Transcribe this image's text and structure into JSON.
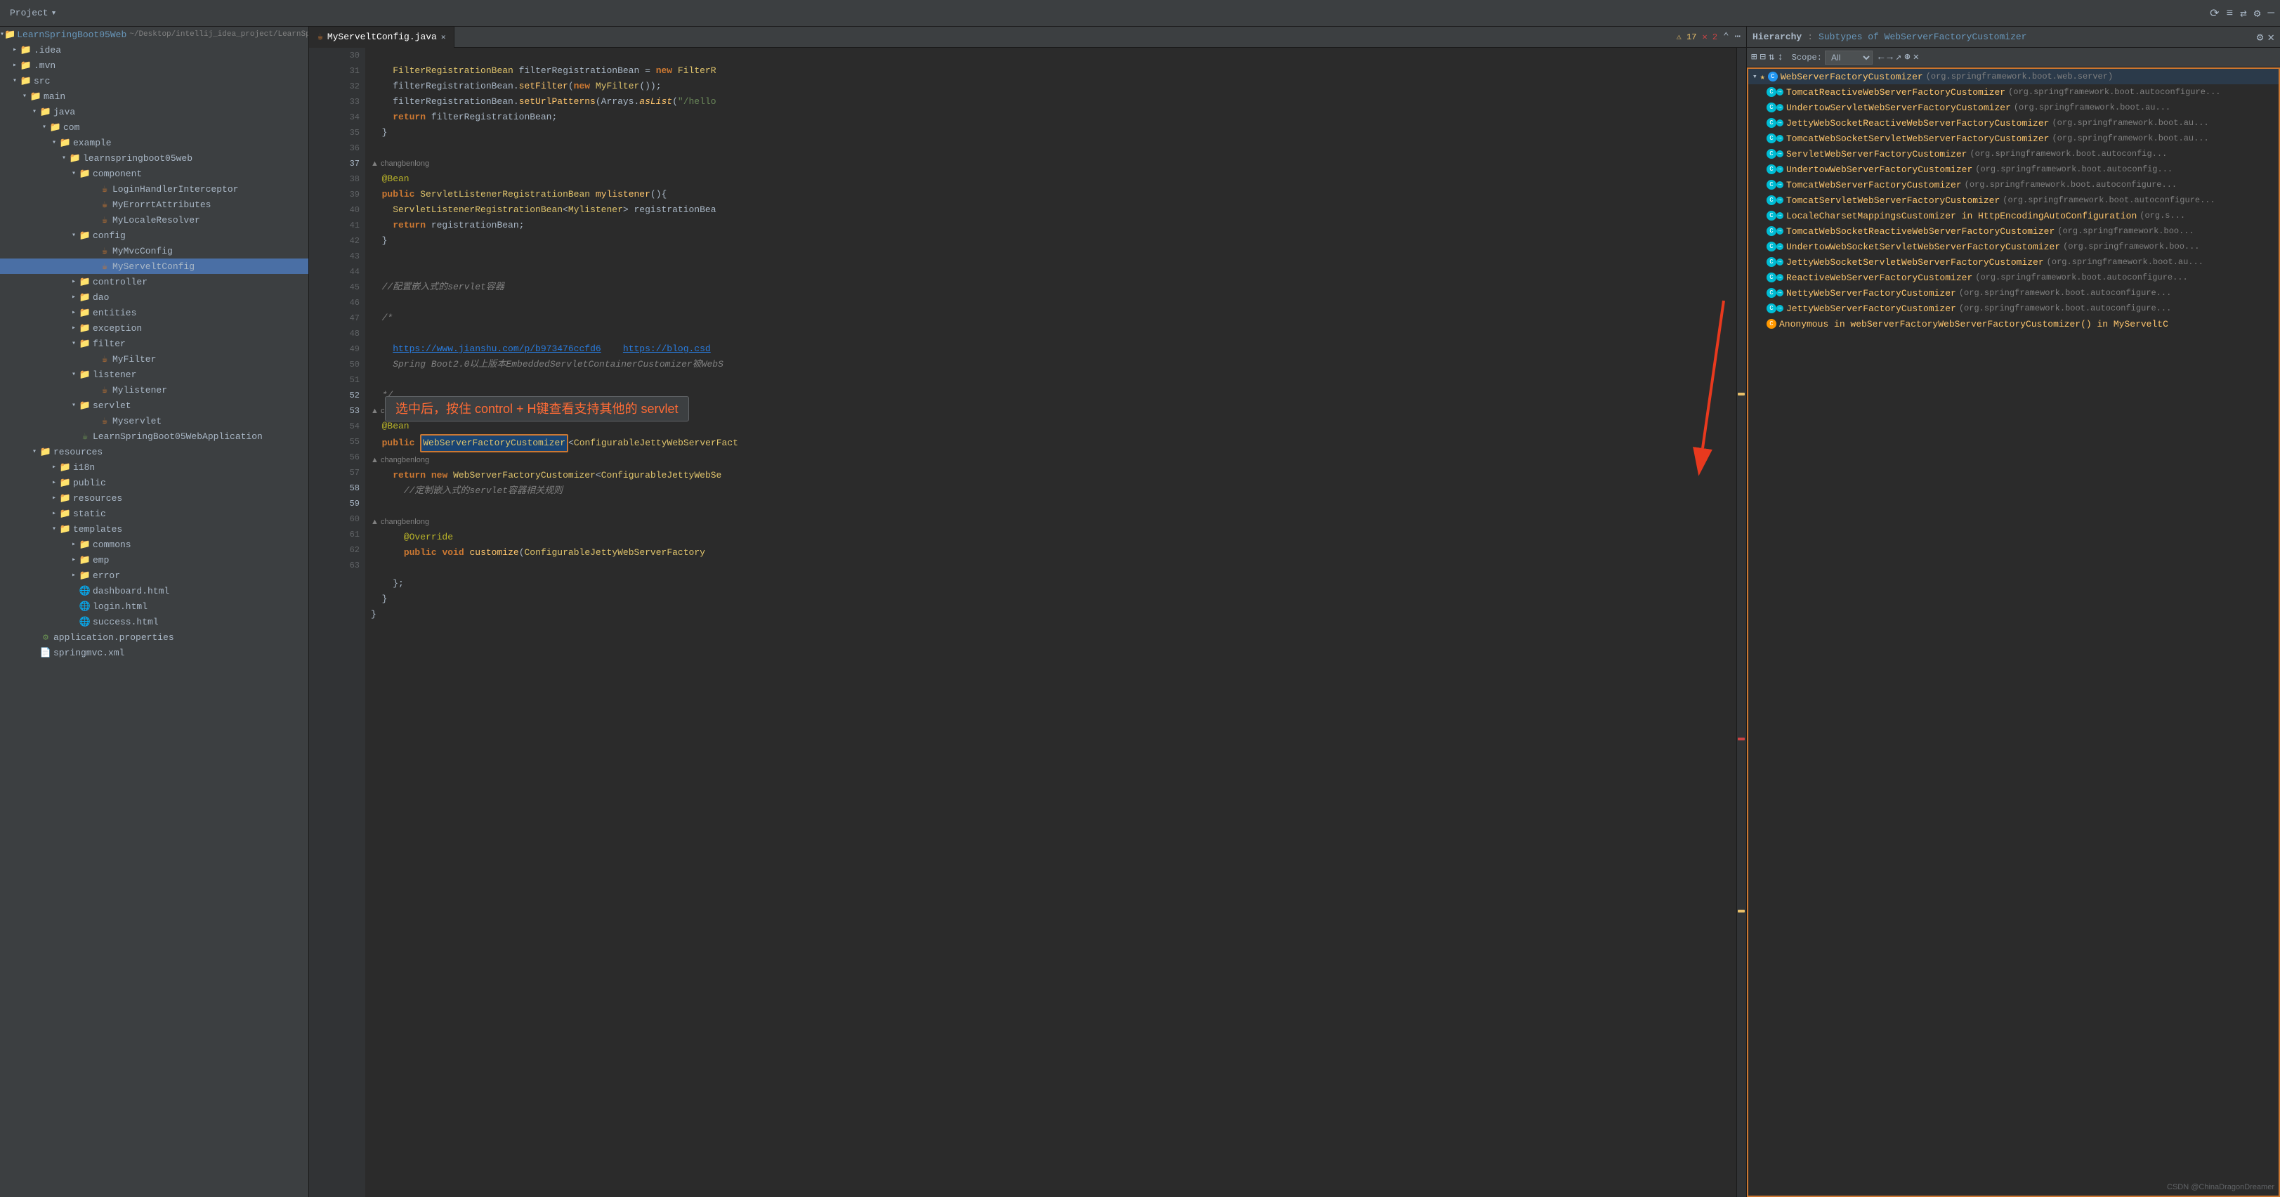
{
  "topbar": {
    "project_label": "Project",
    "dropdown_arrow": "▾"
  },
  "tab": {
    "filename": "MyServeltConfig.java",
    "close": "✕"
  },
  "toolbar": {
    "warnings": "⚠ 17",
    "errors": "✕ 2"
  },
  "sidebar": {
    "title": "Project",
    "items": [
      {
        "id": "root",
        "label": "LearnSpringBoot05Web",
        "sublabel": "~/Desktop/intellij_idea_project/LearnSpringBo...",
        "indent": 0,
        "type": "project",
        "expanded": true
      },
      {
        "id": "idea",
        "label": ".idea",
        "indent": 1,
        "type": "folder",
        "expanded": false
      },
      {
        "id": "mvn",
        "label": ".mvn",
        "indent": 1,
        "type": "folder",
        "expanded": false
      },
      {
        "id": "src",
        "label": "src",
        "indent": 1,
        "type": "folder",
        "expanded": true
      },
      {
        "id": "main",
        "label": "main",
        "indent": 2,
        "type": "folder",
        "expanded": true
      },
      {
        "id": "java",
        "label": "java",
        "indent": 3,
        "type": "folder",
        "expanded": true
      },
      {
        "id": "com",
        "label": "com",
        "indent": 4,
        "type": "package",
        "expanded": true
      },
      {
        "id": "example",
        "label": "example",
        "indent": 5,
        "type": "package",
        "expanded": true
      },
      {
        "id": "learnspringboot05web",
        "label": "learnspringboot05web",
        "indent": 6,
        "type": "package",
        "expanded": true
      },
      {
        "id": "component",
        "label": "component",
        "indent": 7,
        "type": "folder",
        "expanded": true
      },
      {
        "id": "loginhandlerinterceptor",
        "label": "LoginHandlerInterceptor",
        "indent": 8,
        "type": "java"
      },
      {
        "id": "myerrorattributes",
        "label": "MyErorrtAttributes",
        "indent": 8,
        "type": "java"
      },
      {
        "id": "mylocalresolver",
        "label": "MyLocaleResolver",
        "indent": 8,
        "type": "java"
      },
      {
        "id": "config",
        "label": "config",
        "indent": 7,
        "type": "folder",
        "expanded": true
      },
      {
        "id": "mymvcconfig",
        "label": "MyMvcConfig",
        "indent": 8,
        "type": "java"
      },
      {
        "id": "myserveltconfig",
        "label": "MyServeltConfig",
        "indent": 8,
        "type": "java",
        "selected": true
      },
      {
        "id": "controller",
        "label": "controller",
        "indent": 7,
        "type": "folder",
        "expanded": false
      },
      {
        "id": "dao",
        "label": "dao",
        "indent": 7,
        "type": "folder",
        "expanded": false
      },
      {
        "id": "entities",
        "label": "entities",
        "indent": 7,
        "type": "folder",
        "expanded": false
      },
      {
        "id": "exception",
        "label": "exception",
        "indent": 7,
        "type": "folder",
        "expanded": false
      },
      {
        "id": "filter",
        "label": "filter",
        "indent": 7,
        "type": "folder",
        "expanded": true
      },
      {
        "id": "myfilter",
        "label": "MyFilter",
        "indent": 8,
        "type": "java"
      },
      {
        "id": "listener",
        "label": "listener",
        "indent": 7,
        "type": "folder",
        "expanded": true
      },
      {
        "id": "mylistener",
        "label": "Mylistener",
        "indent": 8,
        "type": "java"
      },
      {
        "id": "servlet",
        "label": "servlet",
        "indent": 7,
        "type": "folder",
        "expanded": true
      },
      {
        "id": "myservlet",
        "label": "Myservlet",
        "indent": 8,
        "type": "java"
      },
      {
        "id": "learnapp",
        "label": "LearnSpringBoot05WebApplication",
        "indent": 7,
        "type": "java"
      },
      {
        "id": "resources",
        "label": "resources",
        "indent": 3,
        "type": "folder",
        "expanded": true
      },
      {
        "id": "i18n",
        "label": "i18n",
        "indent": 4,
        "type": "folder",
        "expanded": false
      },
      {
        "id": "public",
        "label": "public",
        "indent": 4,
        "type": "folder",
        "expanded": false
      },
      {
        "id": "resources2",
        "label": "resources",
        "indent": 4,
        "type": "folder",
        "expanded": false
      },
      {
        "id": "static",
        "label": "static",
        "indent": 4,
        "type": "folder",
        "expanded": false
      },
      {
        "id": "templates",
        "label": "templates",
        "indent": 4,
        "type": "folder",
        "expanded": true
      },
      {
        "id": "commons",
        "label": "commons",
        "indent": 5,
        "type": "folder",
        "expanded": false
      },
      {
        "id": "emp",
        "label": "emp",
        "indent": 5,
        "type": "folder",
        "expanded": false
      },
      {
        "id": "error",
        "label": "error",
        "indent": 5,
        "type": "folder",
        "expanded": false
      },
      {
        "id": "dashboard_html",
        "label": "dashboard.html",
        "indent": 5,
        "type": "html"
      },
      {
        "id": "login_html",
        "label": "login.html",
        "indent": 5,
        "type": "html"
      },
      {
        "id": "success_html",
        "label": "success.html",
        "indent": 5,
        "type": "html"
      },
      {
        "id": "app_properties",
        "label": "application.properties",
        "indent": 3,
        "type": "properties"
      },
      {
        "id": "springmvc_xml",
        "label": "springmvc.xml",
        "indent": 3,
        "type": "xml"
      }
    ]
  },
  "code": {
    "lines": [
      {
        "num": 30,
        "content": "",
        "type": "blank"
      },
      {
        "num": 31,
        "content": "    FilterRegistrationBean filterRegistrationBean = new FilterR",
        "type": "code"
      },
      {
        "num": 32,
        "content": "    filterRegistrationBean.setFilter(new MyFilter());",
        "type": "code"
      },
      {
        "num": 33,
        "content": "    filterRegistrationBean.setUrlPatterns(Arrays.asList(\"/hello",
        "type": "code"
      },
      {
        "num": 34,
        "content": "    return filterRegistrationBean;",
        "type": "code"
      },
      {
        "num": 35,
        "content": "  }",
        "type": "code"
      },
      {
        "num": 36,
        "content": "",
        "type": "blank"
      },
      {
        "num": 37,
        "content": "  @Bean",
        "type": "annotation",
        "author": "changbenlong"
      },
      {
        "num": 38,
        "content": "  public ServletListenerRegistrationBean mylistener(){",
        "type": "code"
      },
      {
        "num": 39,
        "content": "    ServletListenerRegistrationBean<Mylistener> registrationBea",
        "type": "code"
      },
      {
        "num": 40,
        "content": "    return registrationBean;",
        "type": "code"
      },
      {
        "num": 41,
        "content": "  }",
        "type": "code"
      },
      {
        "num": 42,
        "content": "",
        "type": "blank"
      },
      {
        "num": 43,
        "content": "",
        "type": "blank"
      },
      {
        "num": 44,
        "content": "  //配置嵌入式的servlet容器",
        "type": "comment"
      },
      {
        "num": 45,
        "content": "",
        "type": "blank"
      },
      {
        "num": 46,
        "content": "  /*",
        "type": "comment"
      },
      {
        "num": 47,
        "content": "",
        "type": "blank"
      },
      {
        "num": 48,
        "content": "    https://www.jianshu.com/p/b973476ccfd6    https://blog.csd",
        "type": "link"
      },
      {
        "num": 49,
        "content": "    Spring Boot2.0以上版本EmbeddedServletContainerCustomizer被WebS",
        "type": "comment"
      },
      {
        "num": 50,
        "content": "",
        "type": "blank"
      },
      {
        "num": 51,
        "content": "  */",
        "type": "comment"
      },
      {
        "num": 52,
        "content": "  @Bean",
        "type": "annotation",
        "author": "changbenlong"
      },
      {
        "num": 53,
        "content": "  public WebServerFactoryCustomizer<ConfigurableJettyWebServerFact",
        "type": "code",
        "highlight": "WebServerFactoryCustomizer"
      },
      {
        "num": 54,
        "content": "",
        "type": "blank",
        "author": "changbenlong"
      },
      {
        "num": 55,
        "content": "    return new WebServerFactoryCustomizer<ConfigurableJettyWebSe",
        "type": "code"
      },
      {
        "num": 56,
        "content": "      //定制嵌入式的servlet容器相关规则",
        "type": "comment"
      },
      {
        "num": 57,
        "content": "",
        "type": "blank"
      },
      {
        "num": 58,
        "content": "      @Override",
        "type": "annotation",
        "author": "changbenlong"
      },
      {
        "num": 59,
        "content": "      public void customize(ConfigurableJettyWebServerFactory",
        "type": "code"
      },
      {
        "num": 60,
        "content": "",
        "type": "blank"
      },
      {
        "num": 61,
        "content": "    };",
        "type": "code"
      },
      {
        "num": 62,
        "content": "  }",
        "type": "code"
      },
      {
        "num": 63,
        "content": "}",
        "type": "code"
      }
    ]
  },
  "hierarchy": {
    "title": "Hierarchy",
    "subtitle": "Subtypes of WebServerFactoryCustomizer",
    "close": "✕",
    "scope_label": "Scope:",
    "scope_value": "All",
    "items": [
      {
        "id": "root",
        "type": "root",
        "expanded": true,
        "icon_type": "star",
        "classname": "WebServerFactoryCustomizer",
        "package": "(org.springframework.boot.web.server)",
        "indent": 0
      },
      {
        "id": "tomcat_reactive",
        "type": "leaf",
        "icon_type": "cyan",
        "classname": "TomcatReactiveWebServerFactoryCustomizer",
        "package": "(org.springframework.boot.autoconfigure...",
        "indent": 1
      },
      {
        "id": "undertow_servlet",
        "type": "leaf",
        "icon_type": "cyan",
        "classname": "UndertowServletWebServerFactoryCustomizer",
        "package": "(org.springframework.boot.au...",
        "indent": 1
      },
      {
        "id": "jetty_websocket_reactive",
        "type": "leaf",
        "icon_type": "cyan",
        "classname": "JettyWebSocketReactiveWebServerFactoryCustomizer",
        "package": "(org.springframework.boot.au...",
        "indent": 1
      },
      {
        "id": "tomcat_websocket",
        "type": "leaf",
        "icon_type": "cyan",
        "classname": "TomcatWebSocketServletWebServerFactoryCustomizer",
        "package": "(org.springframework.boot.au...",
        "indent": 1
      },
      {
        "id": "servlet_web",
        "type": "leaf",
        "icon_type": "cyan",
        "classname": "ServletWebServerFactoryCustomizer",
        "package": "(org.springframework.boot.autoconfig...",
        "indent": 1
      },
      {
        "id": "undertow_web",
        "type": "leaf",
        "icon_type": "cyan",
        "classname": "UndertowWebServerFactoryCustomizer",
        "package": "(org.springframework.boot.autoconfig...",
        "indent": 1
      },
      {
        "id": "tomcat_web",
        "type": "leaf",
        "icon_type": "cyan",
        "classname": "TomcatWebServerFactoryCustomizer",
        "package": "(org.springframework.boot.autoconfigure...",
        "indent": 1
      },
      {
        "id": "tomcat_servlet",
        "type": "leaf",
        "icon_type": "cyan",
        "classname": "TomcatServletWebServerFactoryCustomizer",
        "package": "(org.springframework.boot.autoconfigure...",
        "indent": 1
      },
      {
        "id": "locale_charset",
        "type": "leaf",
        "icon_type": "cyan",
        "classname": "LocaleCharsetMappingsCustomizer in HttpEncodingAutoConfiguration",
        "package": "(org.s...",
        "indent": 1
      },
      {
        "id": "tomcat_websocket_reactive",
        "type": "leaf",
        "icon_type": "cyan",
        "classname": "TomcatWebSocketReactiveWebServerFactoryCustomizer",
        "package": "(org.springframework.boo...",
        "indent": 1
      },
      {
        "id": "undertow_websocket",
        "type": "leaf",
        "icon_type": "cyan",
        "classname": "UndertowWebSocketServletWebServerFactoryCustomizer",
        "package": "(org.springframework.boo...",
        "indent": 1
      },
      {
        "id": "jetty_websocket_servlet",
        "type": "leaf",
        "icon_type": "cyan",
        "classname": "JettyWebSocketServletWebServerFactoryCustomizer",
        "package": "(org.springframework.boot.au...",
        "indent": 1
      },
      {
        "id": "reactive_web",
        "type": "leaf",
        "icon_type": "cyan",
        "classname": "ReactiveWebServerFactoryCustomizer",
        "package": "(org.springframework.boot.autoconfigure...",
        "indent": 1
      },
      {
        "id": "netty_web",
        "type": "leaf",
        "icon_type": "cyan",
        "classname": "NettyWebServerFactoryCustomizer",
        "package": "(org.springframework.boot.autoconfigure...",
        "indent": 1
      },
      {
        "id": "jetty_web",
        "type": "leaf",
        "icon_type": "cyan",
        "classname": "JettyWebServerFactoryCustomizer",
        "package": "(org.springframework.boot.autoconfigure...",
        "indent": 1
      },
      {
        "id": "anonymous",
        "type": "leaf",
        "icon_type": "orange",
        "classname": "Anonymous in webServerFactoryWebServerFactoryCustomizer() in MyServeltC",
        "package": "",
        "indent": 1
      }
    ]
  },
  "annotation": {
    "chinese_text": "选中后，按住 control + H键查看支持其他的 servlet",
    "author_changbenlong": "changbenlong"
  },
  "statusbar": {
    "csdn": "CSDN @ChinaDragonDreamer"
  }
}
